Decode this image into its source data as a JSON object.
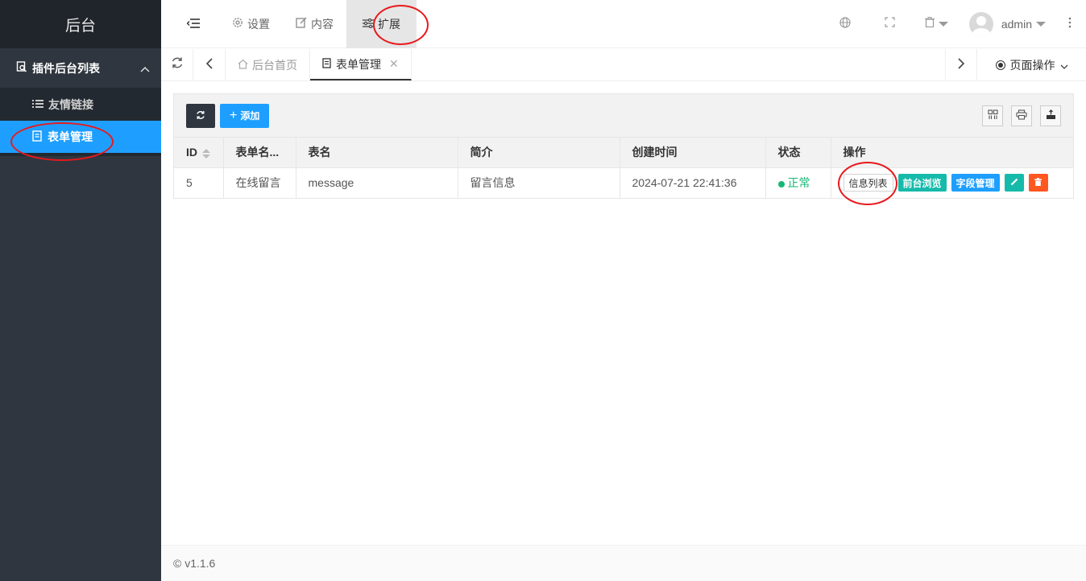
{
  "sidebar": {
    "logo": "后台",
    "group": {
      "label": "插件后台列表",
      "icon": "search-doc-icon"
    },
    "items": [
      {
        "label": "友情链接",
        "icon": "list-icon"
      },
      {
        "label": "表单管理",
        "icon": "doc-icon",
        "active": true
      }
    ]
  },
  "header": {
    "nav": [
      {
        "label": "设置",
        "icon": "gear-icon"
      },
      {
        "label": "内容",
        "icon": "edit-icon"
      },
      {
        "label": "扩展",
        "icon": "sliders-icon",
        "active": true
      }
    ],
    "user": "admin"
  },
  "tabs": {
    "items": [
      {
        "label": "后台首页",
        "icon": "home-icon"
      },
      {
        "label": "表单管理",
        "icon": "doc-icon",
        "active": true
      }
    ],
    "page_ops": "页面操作"
  },
  "toolbar": {
    "add_label": "添加"
  },
  "table": {
    "headers": [
      "ID",
      "表单名...",
      "表名",
      "简介",
      "创建时间",
      "状态",
      "操作"
    ],
    "rows": [
      {
        "id": "5",
        "form_name": "在线留言",
        "table_name": "message",
        "intro": "留言信息",
        "created": "2024-07-21 22:41:36",
        "status": "正常",
        "actions": [
          "信息列表",
          "前台浏览",
          "字段管理"
        ]
      }
    ]
  },
  "footer": {
    "version": "© v1.1.6"
  },
  "colors": {
    "accent": "#1e9fff",
    "sidebar": "#2f363f",
    "success": "#16b777",
    "danger": "#ff5722",
    "teal": "#16baaa",
    "annotation": "#e8191c"
  }
}
